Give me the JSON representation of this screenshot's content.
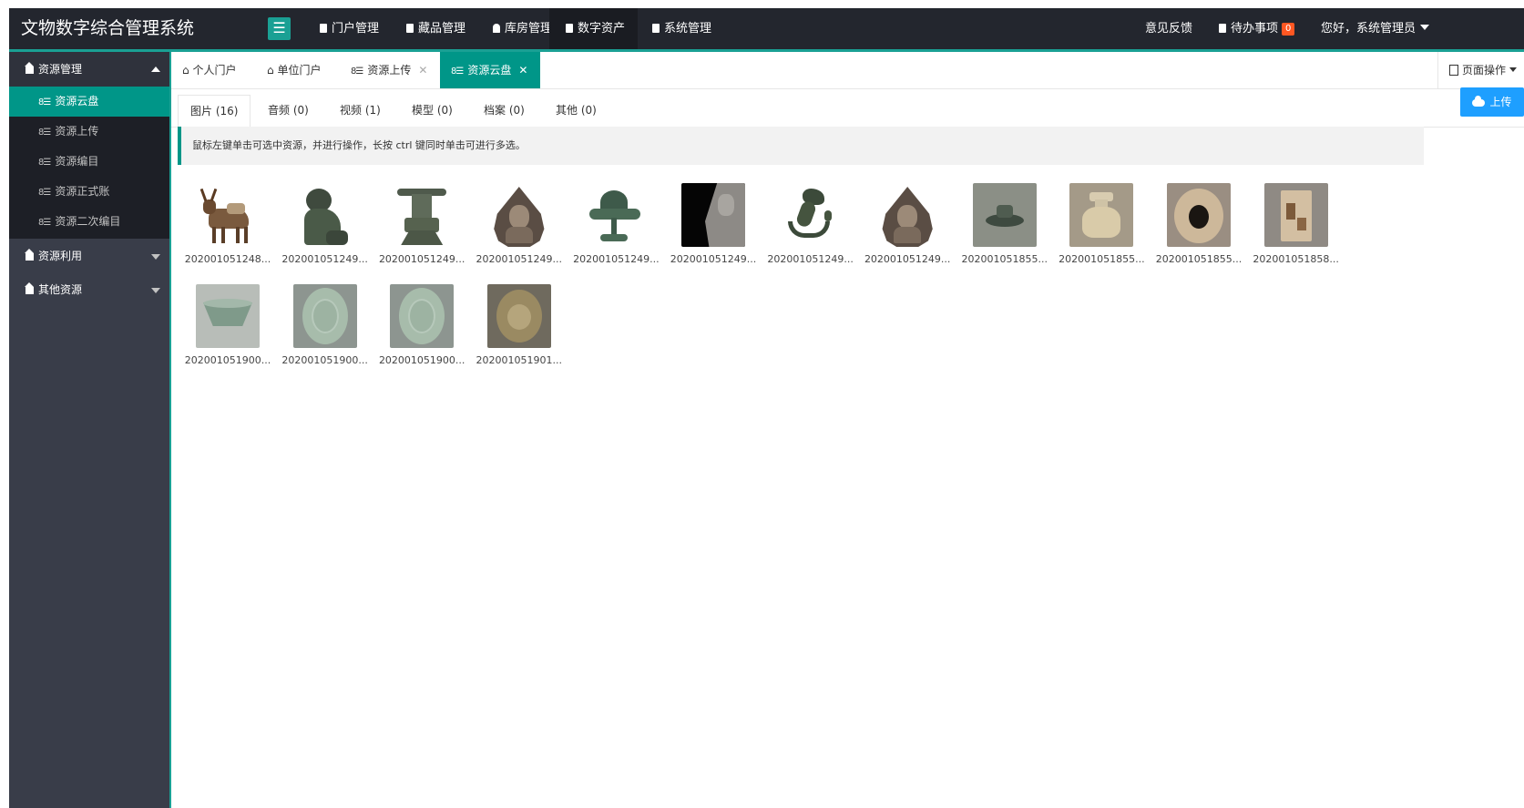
{
  "app": {
    "title": "文物数字综合管理系统"
  },
  "topnav": {
    "items": [
      {
        "label": "门户管理",
        "icon": "doc-icon"
      },
      {
        "label": "藏品管理",
        "icon": "doc-icon"
      },
      {
        "label": "库房管理",
        "icon": "user-icon"
      },
      {
        "label": "数字资产",
        "icon": "doc-icon",
        "active": true
      },
      {
        "label": "系统管理",
        "icon": "doc-icon"
      }
    ],
    "feedback": "意见反馈",
    "todo_label": "待办事项",
    "todo_count": "0",
    "greeting": "您好，系统管理员"
  },
  "sidebar": {
    "groups": [
      {
        "label": "资源管理",
        "expanded": true,
        "items": [
          {
            "label": "资源云盘",
            "active": true
          },
          {
            "label": "资源上传"
          },
          {
            "label": "资源编目"
          },
          {
            "label": "资源正式账"
          },
          {
            "label": "资源二次编目"
          }
        ]
      },
      {
        "label": "资源利用",
        "expanded": false
      },
      {
        "label": "其他资源",
        "expanded": false
      }
    ]
  },
  "tabs": [
    {
      "label": "个人门户",
      "icon": "home-icon",
      "closable": false
    },
    {
      "label": "单位门户",
      "icon": "home-icon",
      "closable": false
    },
    {
      "label": "资源上传",
      "icon": "list-icon",
      "closable": true
    },
    {
      "label": "资源云盘",
      "icon": "list-icon",
      "closable": true,
      "active": true
    }
  ],
  "page_op": "页面操作",
  "type_tabs": [
    {
      "label": "图片 (16)",
      "active": true
    },
    {
      "label": "音频 (0)"
    },
    {
      "label": "视频 (1)"
    },
    {
      "label": "模型 (0)"
    },
    {
      "label": "档案 (0)"
    },
    {
      "label": "其他 (0)"
    }
  ],
  "upload_label": "上传",
  "tip": "鼠标左键单击可选中资源，并进行操作，长按 ctrl 键同时单击可进行多选。",
  "files": [
    {
      "name": "202001051248...",
      "thumb": "ox-figurine"
    },
    {
      "name": "202001051249...",
      "thumb": "lion-statue"
    },
    {
      "name": "202001051249...",
      "thumb": "bronze-vessel"
    },
    {
      "name": "202001051249...",
      "thumb": "buddha-relief"
    },
    {
      "name": "202001051249...",
      "thumb": "bronze-lamp"
    },
    {
      "name": "202001051249...",
      "thumb": "stone-carving"
    },
    {
      "name": "202001051249...",
      "thumb": "bronze-dragon"
    },
    {
      "name": "202001051249...",
      "thumb": "buddha-relief"
    },
    {
      "name": "202001051855...",
      "thumb": "ceramic-dish"
    },
    {
      "name": "202001051855...",
      "thumb": "ceramic-jar"
    },
    {
      "name": "202001051855...",
      "thumb": "ceramic-bowl-top"
    },
    {
      "name": "202001051858...",
      "thumb": "ceramic-tile"
    },
    {
      "name": "202001051900...",
      "thumb": "celadon-bowl"
    },
    {
      "name": "202001051900...",
      "thumb": "celadon-plate"
    },
    {
      "name": "202001051900...",
      "thumb": "celadon-plate"
    },
    {
      "name": "202001051901...",
      "thumb": "brown-bowl"
    }
  ],
  "colors": {
    "accent": "#009688",
    "topbar": "#23262e",
    "sidebar": "#393d49",
    "upload": "#1e9fff",
    "badge": "#ff5722"
  }
}
